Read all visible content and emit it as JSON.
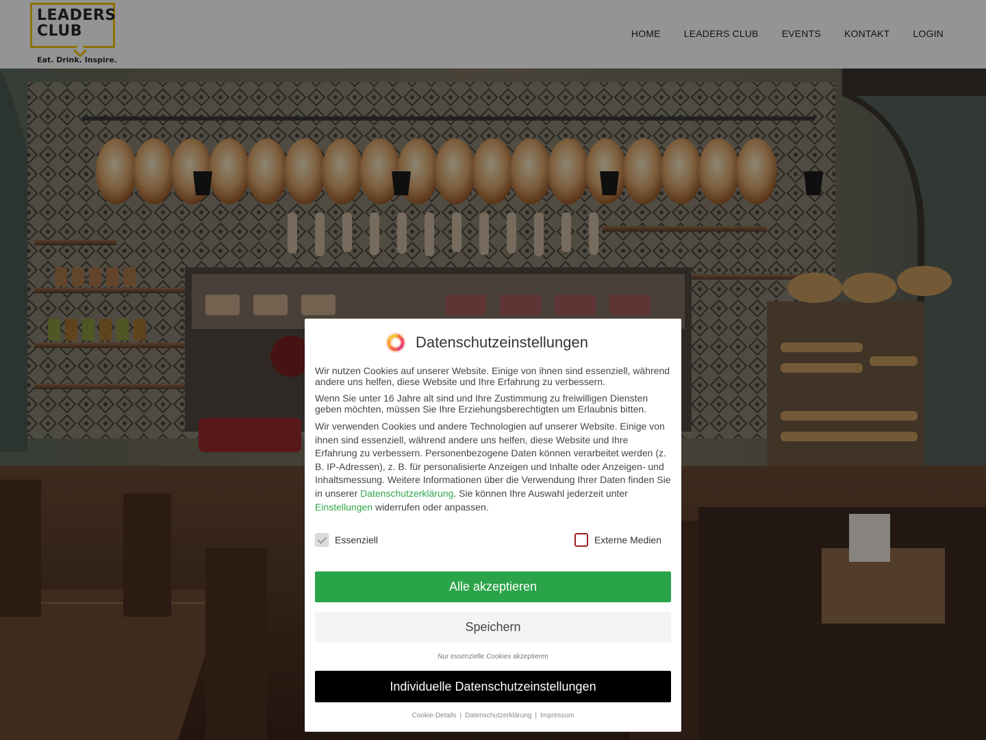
{
  "header": {
    "logo": {
      "line1": "LEADERS",
      "line2": "CLUB",
      "tagline": "Eat. Drink. Inspire."
    },
    "nav": [
      "HOME",
      "LEADERS CLUB",
      "EVENTS",
      "KONTAKT",
      "LOGIN"
    ]
  },
  "dialog": {
    "icon": "cookie-flower-icon",
    "title": "Datenschutzeinstellungen",
    "p1": "Wir nutzen Cookies auf unserer Website. Einige von ihnen sind essenziell, während andere uns helfen, diese Website und Ihre Erfahrung zu verbessern.",
    "p2": "Wenn Sie unter 16 Jahre alt sind und Ihre Zustimmung zu freiwilligen Diensten geben möchten, müssen Sie Ihre Erziehungsberechtigten um Erlaubnis bitten.",
    "p3_a": "Wir verwenden Cookies und andere Technologien auf unserer Website. Einige von ihnen sind essenziell, während andere uns helfen, diese Website und Ihre Erfahrung zu verbessern. Personenbezogene Daten können verarbeitet werden (z. B. IP-Adressen), z. B. für personalisierte Anzeigen und Inhalte oder Anzeigen- und Inhaltsmessung. Weitere Informationen über die Verwendung Ihrer Daten finden Sie in unserer ",
    "p3_link1": "Datenschutzerklärung",
    "p3_b": ". Sie können Ihre Auswahl jederzeit unter ",
    "p3_link2": "Einstellungen",
    "p3_c": " widerrufen oder anpassen.",
    "toggles": [
      {
        "label": "Essenziell",
        "checked": true
      },
      {
        "label": "Externe Medien",
        "checked": false
      }
    ],
    "accept_all": "Alle akzeptieren",
    "save": "Speichern",
    "only_essential": "Nur essenzielle Cookies akzeptieren",
    "individual": "Individuelle Datenschutzeinstellungen",
    "footer_links": [
      "Cookie-Details",
      "Datenschutzerklärung",
      "Impressum"
    ],
    "colors": {
      "accept": "#2aa449",
      "link": "#2ea548",
      "individual": "#000000"
    }
  }
}
